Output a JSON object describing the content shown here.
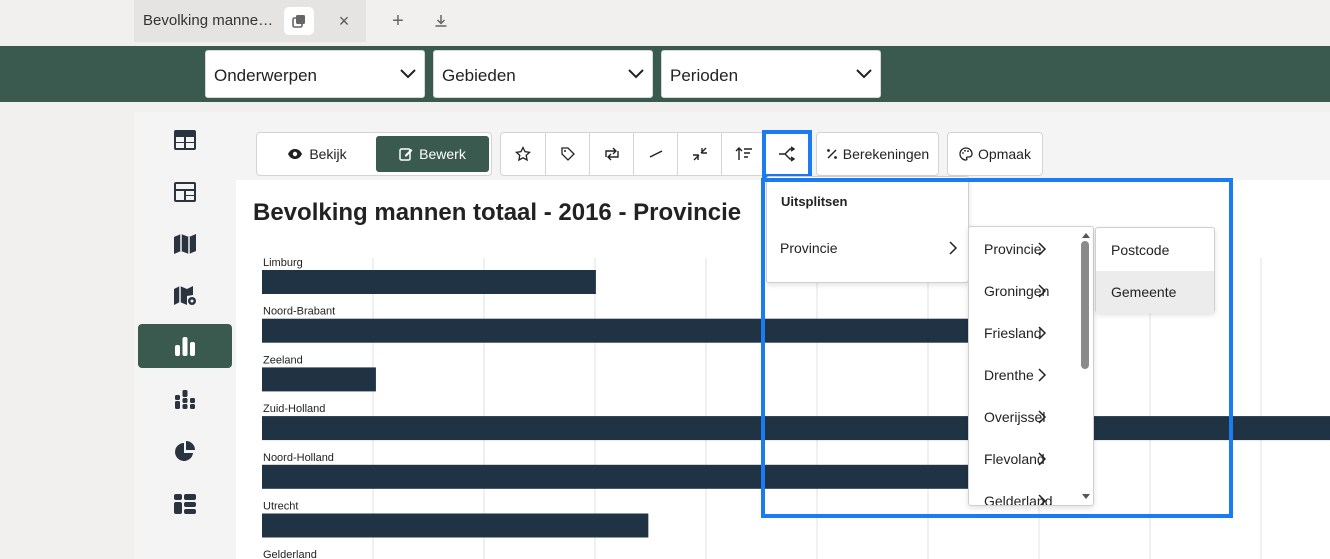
{
  "browser": {
    "tab_title": "Bevolking manne…",
    "tab_close": "×",
    "new_tab": "+",
    "download": "download"
  },
  "selectors": [
    {
      "label": "Onderwerpen"
    },
    {
      "label": "Gebieden"
    },
    {
      "label": "Perioden"
    }
  ],
  "sidebar": {
    "items": [
      {
        "icon": "table-icon"
      },
      {
        "icon": "dashboard-icon"
      },
      {
        "icon": "map-icon"
      },
      {
        "icon": "map-settings-icon"
      },
      {
        "icon": "bar-chart-icon",
        "active": true
      },
      {
        "icon": "stacked-chart-icon"
      },
      {
        "icon": "pie-chart-icon"
      },
      {
        "icon": "widgets-icon"
      }
    ]
  },
  "toolbar": {
    "view_label": "Bekijk",
    "edit_label": "Bewerk",
    "icons": [
      "star-icon",
      "tag-icon",
      "swap-icon",
      "line-icon",
      "collapse-icon",
      "sort-icon",
      "split-icon"
    ],
    "calculations_label": "Berekeningen",
    "format_label": "Opmaak"
  },
  "chart": {
    "title": "Bevolking mannen totaal - 2016 - Provincie"
  },
  "chart_data": {
    "type": "bar",
    "orientation": "horizontal",
    "title": "Bevolking mannen totaal - 2016 - Provincie",
    "categories": [
      "Limburg",
      "Noord-Brabant",
      "Zeeland",
      "Zuid-Holland",
      "Noord-Holland",
      "Utrecht",
      "Gelderland"
    ],
    "values": [
      554000,
      1249000,
      189000,
      1772000,
      1376000,
      641000,
      null
    ],
    "xlim": [
      0,
      1840000
    ],
    "grid": true,
    "color": "#1f3345"
  },
  "split_menu": {
    "header": "Uitsplitsen",
    "item": "Provincie"
  },
  "province_menu": {
    "items": [
      "Provincie",
      "Groningen",
      "Friesland",
      "Drenthe",
      "Overijssel",
      "Flevoland",
      "Gelderland"
    ]
  },
  "sub_menu": {
    "items": [
      "Postcode",
      "Gemeente"
    ],
    "hovered": "Gemeente"
  }
}
